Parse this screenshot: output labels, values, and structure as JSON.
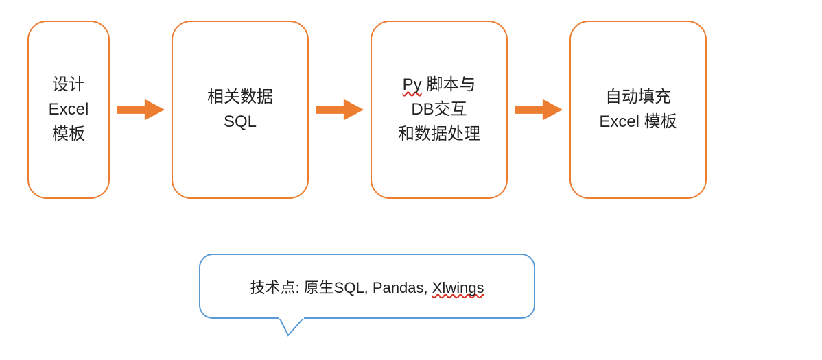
{
  "nodes": {
    "n1_l1": "设计",
    "n1_l2": "Excel",
    "n1_l3": "模板",
    "n2_l1": "相关数据",
    "n2_l2": "SQL",
    "n3_l1_a": "Py",
    "n3_l1_b": " 脚本与",
    "n3_l2": "DB交互",
    "n3_l3": "和数据处理",
    "n4_l1": "自动填充",
    "n4_l2": "Excel 模板"
  },
  "callout": {
    "prefix": "技术点: 原生SQL, Pandas, ",
    "squiggle": "Xlwings"
  },
  "colors": {
    "node_border": "#ED7D31",
    "arrow_fill": "#ED7D31",
    "callout_border": "#5B9BD5"
  }
}
